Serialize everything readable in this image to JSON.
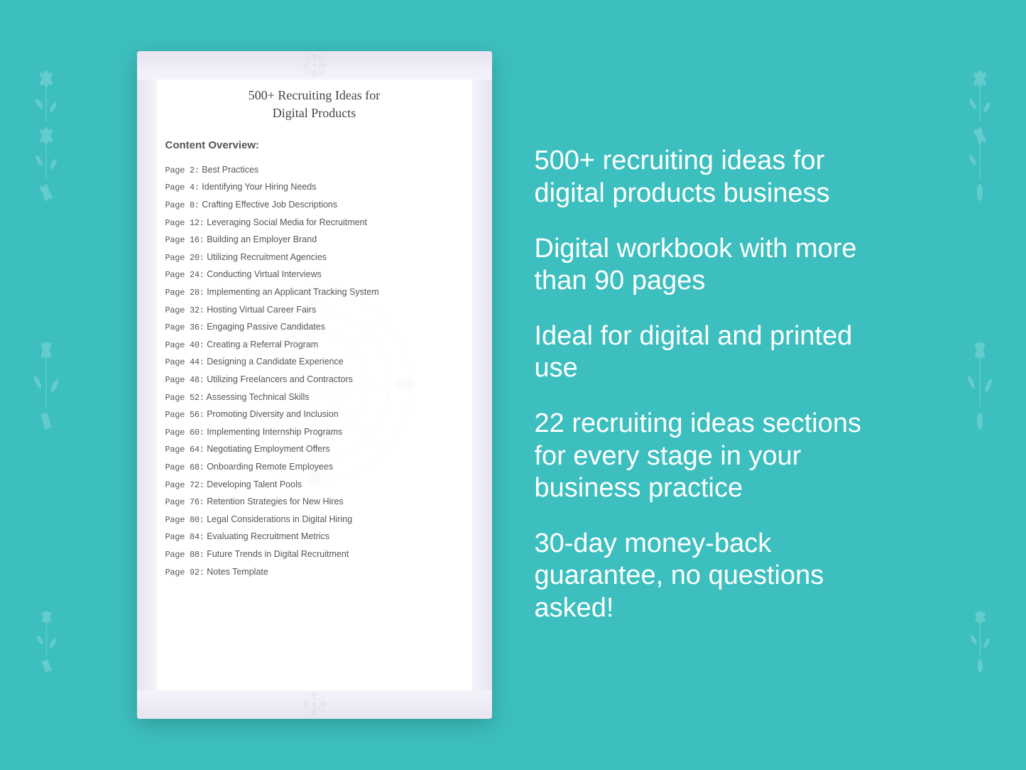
{
  "background_color": "#3dbfbf",
  "document": {
    "title_line1": "500+ Recruiting Ideas for",
    "title_line2": "Digital Products",
    "section_label": "Content Overview:",
    "toc_items": [
      {
        "page": "Page  2:",
        "title": "Best Practices"
      },
      {
        "page": "Page  4:",
        "title": "Identifying Your Hiring Needs"
      },
      {
        "page": "Page  8:",
        "title": "Crafting Effective Job Descriptions"
      },
      {
        "page": "Page 12:",
        "title": "Leveraging Social Media for Recruitment"
      },
      {
        "page": "Page 16:",
        "title": "Building an Employer Brand"
      },
      {
        "page": "Page 20:",
        "title": "Utilizing Recruitment Agencies"
      },
      {
        "page": "Page 24:",
        "title": "Conducting Virtual Interviews"
      },
      {
        "page": "Page 28:",
        "title": "Implementing an Applicant Tracking System"
      },
      {
        "page": "Page 32:",
        "title": "Hosting Virtual Career Fairs"
      },
      {
        "page": "Page 36:",
        "title": "Engaging Passive Candidates"
      },
      {
        "page": "Page 40:",
        "title": "Creating a Referral Program"
      },
      {
        "page": "Page 44:",
        "title": "Designing a Candidate Experience"
      },
      {
        "page": "Page 48:",
        "title": "Utilizing Freelancers and Contractors"
      },
      {
        "page": "Page 52:",
        "title": "Assessing Technical Skills"
      },
      {
        "page": "Page 56:",
        "title": "Promoting Diversity and Inclusion"
      },
      {
        "page": "Page 60:",
        "title": "Implementing Internship Programs"
      },
      {
        "page": "Page 64:",
        "title": "Negotiating Employment Offers"
      },
      {
        "page": "Page 68:",
        "title": "Onboarding Remote Employees"
      },
      {
        "page": "Page 72:",
        "title": "Developing Talent Pools"
      },
      {
        "page": "Page 76:",
        "title": "Retention Strategies for New Hires"
      },
      {
        "page": "Page 80:",
        "title": "Legal Considerations in Digital Hiring"
      },
      {
        "page": "Page 84:",
        "title": "Evaluating Recruitment Metrics"
      },
      {
        "page": "Page 88:",
        "title": "Future Trends in Digital Recruitment"
      },
      {
        "page": "Page 92:",
        "title": "Notes Template"
      }
    ]
  },
  "features": [
    {
      "id": "feature1",
      "text": "500+ recruiting ideas for digital products business"
    },
    {
      "id": "feature2",
      "text": "Digital workbook with more than 90 pages"
    },
    {
      "id": "feature3",
      "text": "Ideal for digital and printed use"
    },
    {
      "id": "feature4",
      "text": "22 recruiting ideas sections for every stage in your business practice"
    },
    {
      "id": "feature5",
      "text": "30-day money-back guarantee, no questions asked!"
    }
  ]
}
